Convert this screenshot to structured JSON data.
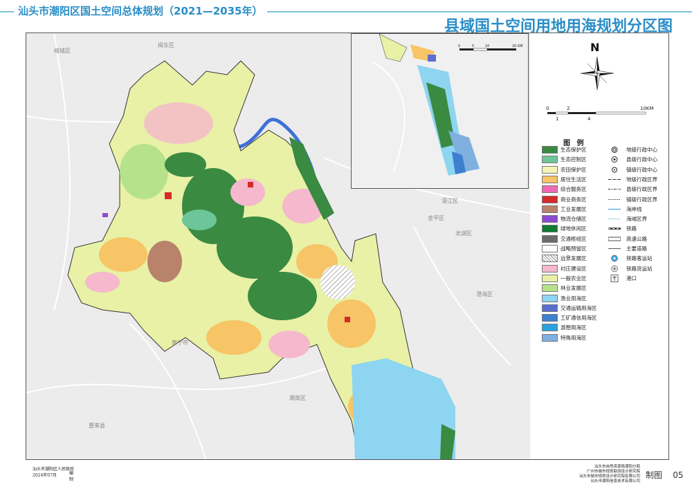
{
  "header": {
    "plan_title": "汕头市潮阳区国土空间总体规划（2021—2035年）",
    "map_title": "县域国土空间用地用海规划分区图"
  },
  "north": {
    "label": "N"
  },
  "scale_main": {
    "ticks": [
      "0",
      "2",
      "10KM"
    ],
    "sub_ticks": [
      "1",
      "4"
    ]
  },
  "scale_inset": {
    "ticks": [
      "0",
      "5",
      "10",
      "20 KM"
    ]
  },
  "legend": {
    "title": "图 例",
    "zones": [
      {
        "label": "生态保护区",
        "color": "#3a8a42"
      },
      {
        "label": "生态控制区",
        "color": "#6fc59a"
      },
      {
        "label": "农田保护区",
        "color": "#f6f3b4"
      },
      {
        "label": "居住生活区",
        "color": "#f7c466"
      },
      {
        "label": "综合服务区",
        "color": "#ef6ab5"
      },
      {
        "label": "商业商务区",
        "color": "#d42a2a"
      },
      {
        "label": "工业发展区",
        "color": "#b9826a"
      },
      {
        "label": "物流仓储区",
        "color": "#8b4bd0"
      },
      {
        "label": "绿地休闲区",
        "color": "#107a30"
      },
      {
        "label": "交通枢纽区",
        "color": "#6b6b6b"
      },
      {
        "label": "战略预留区",
        "color": "#ffffff"
      },
      {
        "label": "远景发展区",
        "color": "hatch"
      },
      {
        "label": "村庄建设区",
        "color": "#f5b8cc"
      },
      {
        "label": "一般农业区",
        "color": "#e8f1a6"
      },
      {
        "label": "林业发展区",
        "color": "#b5e28a"
      },
      {
        "label": "渔业用海区",
        "color": "#8dd5f0"
      },
      {
        "label": "交通运输用海区",
        "color": "#5a6fd0"
      },
      {
        "label": "工矿通信用海区",
        "color": "#3e7fd0"
      },
      {
        "label": "游憩用海区",
        "color": "#2aa2e0"
      },
      {
        "label": "特殊用海区",
        "color": "#7fb0e0"
      }
    ],
    "symbols": [
      {
        "label": "地级行政中心",
        "icon": "prefecture-center-icon"
      },
      {
        "label": "县级行政中心",
        "icon": "county-center-icon"
      },
      {
        "label": "镇级行政中心",
        "icon": "town-center-icon"
      },
      {
        "label": "地级行政区界",
        "icon": "prefecture-boundary-icon"
      },
      {
        "label": "县级行政区界",
        "icon": "county-boundary-icon"
      },
      {
        "label": "镇级行政区界",
        "icon": "town-boundary-icon"
      },
      {
        "label": "海岸线",
        "icon": "coastline-icon"
      },
      {
        "label": "海域区界",
        "icon": "sea-boundary-icon"
      },
      {
        "label": "铁路",
        "icon": "railway-icon"
      },
      {
        "label": "高速公路",
        "icon": "expressway-icon"
      },
      {
        "label": "主要道路",
        "icon": "main-road-icon"
      },
      {
        "label": "铁路客运站",
        "icon": "passenger-station-icon"
      },
      {
        "label": "铁路货运站",
        "icon": "freight-station-icon"
      },
      {
        "label": "港口",
        "icon": "port-icon"
      }
    ]
  },
  "map_labels": {
    "neighbors": [
      "榕城区",
      "揭东区",
      "濠江区",
      "金平区",
      "龙湖区",
      "普宁市",
      "惠来县",
      "潮南区",
      "澄海区"
    ]
  },
  "footer": {
    "gov": "汕头市潮阳区人民政府",
    "date": "2024年07月",
    "role": "编制",
    "credits": [
      "汕头市自然资源局潮阳分局",
      "广州市城市规划勘测设计研究院",
      "汕头市城市规划设计研究院有限公司",
      "汕头市潮阳信息技术有限公司"
    ],
    "page_label": "制图",
    "page_number": "05"
  }
}
